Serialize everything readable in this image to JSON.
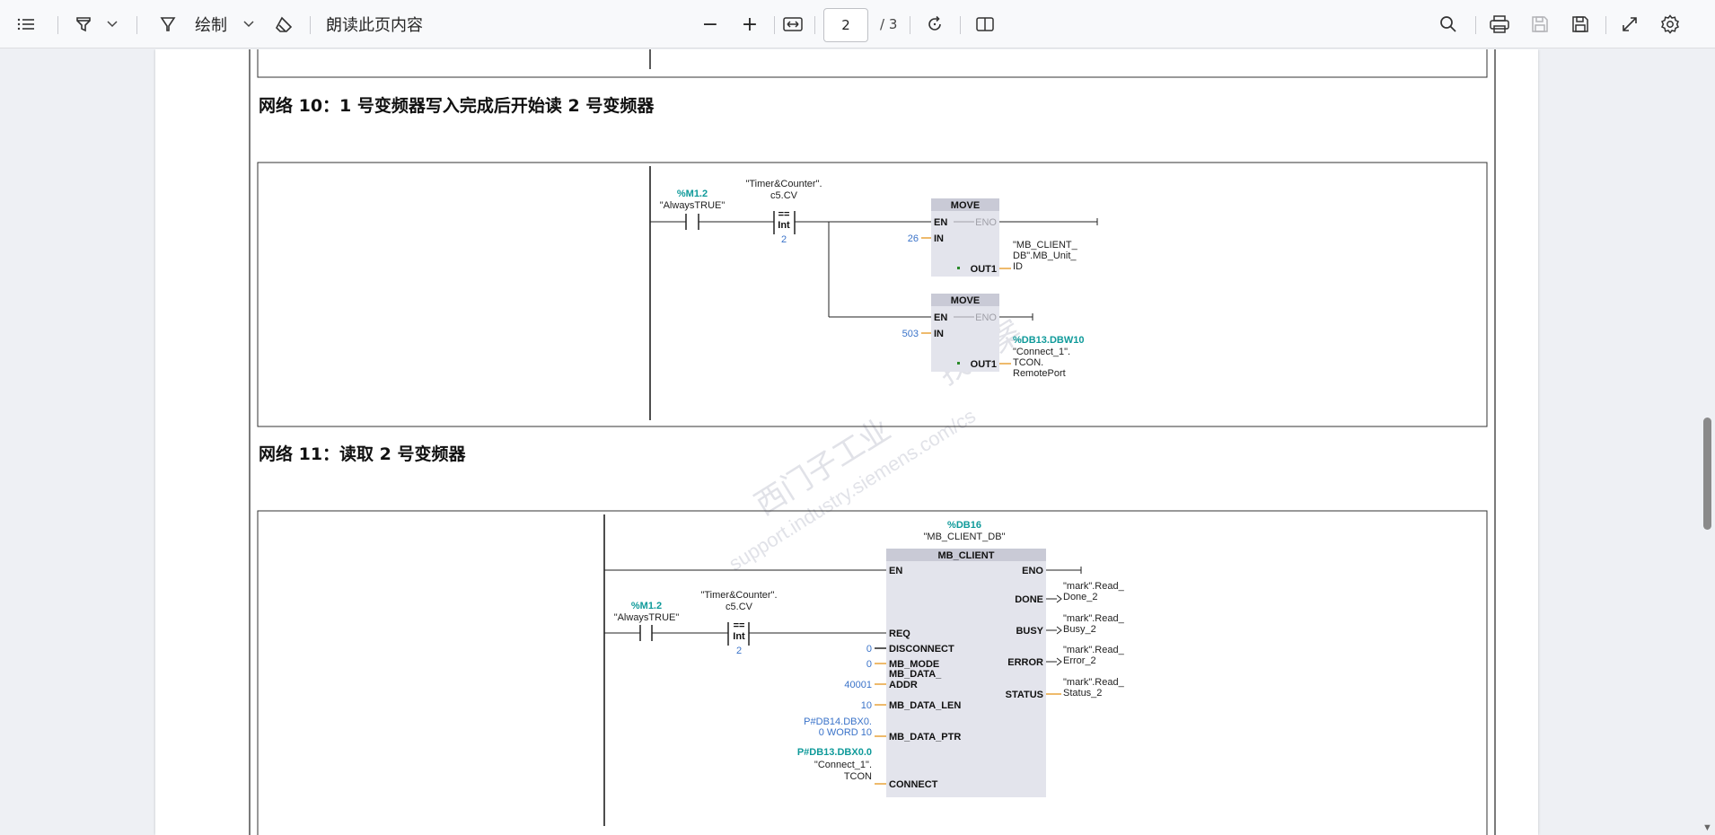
{
  "toolbar": {
    "contents_icon": "contents-list-icon",
    "highlight_icon": "highlighter-icon",
    "draw_label": "绘制",
    "eraser_icon": "eraser-icon",
    "read_aloud_label": "朗读此页内容",
    "zoom_out": "−",
    "zoom_in": "+",
    "page_current": "2",
    "page_total": "/ 3"
  },
  "page": {
    "network10_heading": "网络 10：1 号变频器写入完成后开始读 2 号变频器",
    "network11_heading": "网络 11：读取 2 号变频器",
    "watermark_line1": "西门子工业",
    "watermark_line2": "support.industry.siemens.com/cs",
    "watermark_line3": "找答案"
  },
  "net10": {
    "contact_addr": "%M1.2",
    "contact_name": "\"AlwaysTRUE\"",
    "cmp_tag1": "\"Timer&Counter\".",
    "cmp_tag2": "c5.CV",
    "cmp_op": "==",
    "cmp_type": "Int",
    "cmp_value": "2",
    "move1": {
      "title": "MOVE",
      "en": "EN",
      "eno": "ENO",
      "in_pin": "IN",
      "in_value": "26",
      "out_pin": "OUT1",
      "out_tag1": "\"MB_CLIENT_",
      "out_tag2": "DB\".MB_Unit_",
      "out_tag3": "ID"
    },
    "move2": {
      "title": "MOVE",
      "en": "EN",
      "eno": "ENO",
      "in_pin": "IN",
      "in_value": "503",
      "out_pin": "OUT1",
      "out_addr": "%DB13.DBW10",
      "out_tag1": "\"Connect_1\".",
      "out_tag2": "TCON.",
      "out_tag3": "RemotePort"
    }
  },
  "net11": {
    "instance_addr": "%DB16",
    "instance_name": "\"MB_CLIENT_DB\"",
    "block_title": "MB_CLIENT",
    "contact_addr": "%M1.2",
    "contact_name": "\"AlwaysTRUE\"",
    "cmp_tag1": "\"Timer&Counter\".",
    "cmp_tag2": "c5.CV",
    "cmp_op": "==",
    "cmp_type": "Int",
    "cmp_value": "2",
    "in_pins": {
      "en": "EN",
      "req": "REQ",
      "disconnect": "DISCONNECT",
      "mb_mode": "MB_MODE",
      "mb_data_addr1": "MB_DATA_",
      "mb_data_addr2": "ADDR",
      "mb_data_len": "MB_DATA_LEN",
      "mb_data_ptr": "MB_DATA_PTR",
      "connect": "CONNECT"
    },
    "in_values": {
      "disconnect": "0",
      "mb_mode": "0",
      "mb_data_addr": "40001",
      "mb_data_len": "10",
      "ptr1": "P#DB14.DBX0.",
      "ptr2": "0 WORD 10",
      "connect_addr": "P#DB13.DBX0.0",
      "connect_tag1": "\"Connect_1\".",
      "connect_tag2": "TCON"
    },
    "out_pins": {
      "eno": "ENO",
      "done": "DONE",
      "busy": "BUSY",
      "error": "ERROR",
      "status": "STATUS"
    },
    "out_tags": {
      "done1": "\"mark\".Read_",
      "done2": "Done_2",
      "busy1": "\"mark\".Read_",
      "busy2": "Busy_2",
      "error1": "\"mark\".Read_",
      "error2": "Error_2",
      "status1": "\"mark\".Read_",
      "status2": "Status_2"
    }
  }
}
